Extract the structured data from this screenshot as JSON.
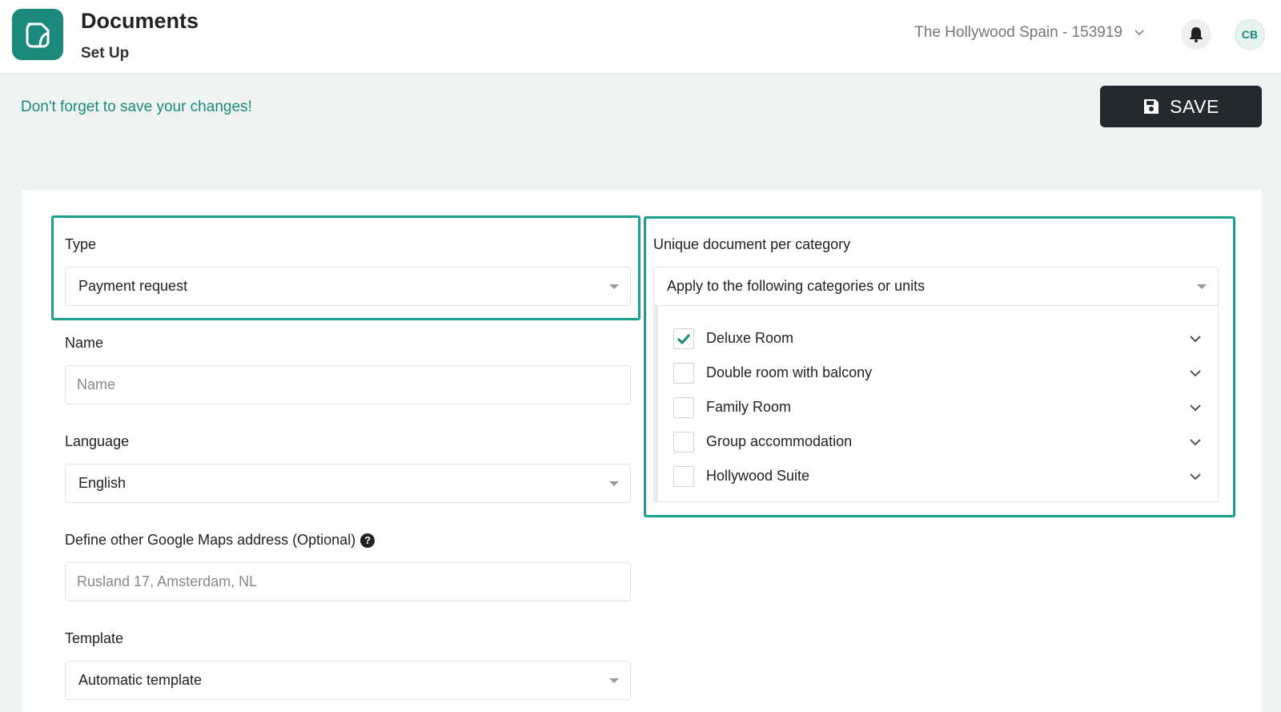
{
  "header": {
    "title": "Documents",
    "subtitle": "Set Up",
    "property_selector": "The Hollywood Spain - 153919",
    "avatar_initials": "CB"
  },
  "toolbar": {
    "notice": "Don't forget to save your changes!",
    "save_label": "SAVE"
  },
  "form": {
    "type": {
      "label": "Type",
      "value": "Payment request"
    },
    "name": {
      "label": "Name",
      "placeholder": "Name",
      "value": ""
    },
    "language": {
      "label": "Language",
      "value": "English"
    },
    "maps": {
      "label": "Define other Google Maps address (Optional)",
      "placeholder": "Rusland 17, Amsterdam, NL",
      "value": ""
    },
    "template": {
      "label": "Template",
      "value": "Automatic template"
    }
  },
  "categories": {
    "label": "Unique document per category",
    "mode_value": "Apply to the following categories or units",
    "items": [
      {
        "label": "Deluxe Room",
        "checked": true
      },
      {
        "label": "Double room with balcony",
        "checked": false
      },
      {
        "label": "Family Room",
        "checked": false
      },
      {
        "label": "Group accommodation",
        "checked": false
      },
      {
        "label": "Hollywood Suite",
        "checked": false
      }
    ]
  },
  "colors": {
    "accent": "#1b8a7c",
    "highlight": "#1aa08b",
    "save_button": "#222a2f"
  },
  "icons": {
    "app": "document-icon",
    "bell": "bell-icon",
    "save": "floppy-disk-icon",
    "help": "question-circle-icon",
    "dropdown": "chevron-down-icon",
    "check": "checkmark-icon"
  }
}
